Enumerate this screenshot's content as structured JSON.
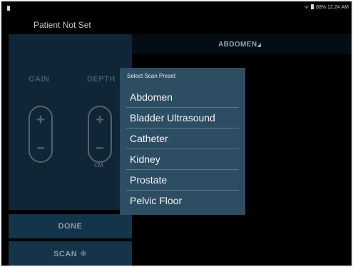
{
  "status_bar": {
    "text": "88% 12:24 AM",
    "wifi_icon": "wifi-icon",
    "battery_icon": "battery-icon"
  },
  "header": {
    "patient_label": "Patient Not Set"
  },
  "preset_button": {
    "label": "ABDOMEN"
  },
  "controls": {
    "gain_label": "GAIN",
    "depth_label": "DEPTH",
    "plus_symbol": "+",
    "minus_symbol": "−",
    "depth_unit": "CM"
  },
  "buttons": {
    "done_label": "DONE",
    "scan_label": "SCAN",
    "scan_icon": "❄"
  },
  "preset_menu": {
    "title": "Select Scan Preset",
    "items": [
      {
        "label": "Abdomen"
      },
      {
        "label": "Bladder Ultrasound"
      },
      {
        "label": "Catheter"
      },
      {
        "label": "Kidney"
      },
      {
        "label": "Prostate"
      },
      {
        "label": "Pelvic Floor"
      }
    ]
  },
  "colors": {
    "background": "#000000",
    "panel": "#102637",
    "button": "#14344a",
    "menu": "#2d4d63"
  }
}
